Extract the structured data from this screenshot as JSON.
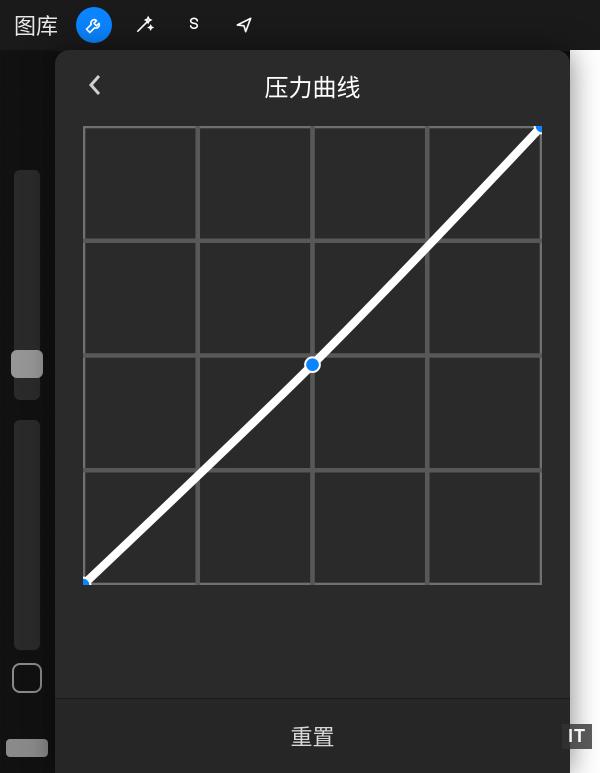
{
  "toolbar": {
    "gallery_label": "图库",
    "icons": {
      "adjust": "wrench-icon",
      "magic": "wand-icon",
      "shape": "s-icon",
      "pointer": "arrow-icon"
    },
    "active": "adjust"
  },
  "panel": {
    "title": "压力曲线",
    "reset_label": "重置"
  },
  "chart_data": {
    "type": "line",
    "title": "压力曲线",
    "xlabel": "",
    "ylabel": "",
    "xlim": [
      0,
      1
    ],
    "ylim": [
      0,
      1
    ],
    "grid_rows": 4,
    "grid_cols": 4,
    "series": [
      {
        "name": "pressure-curve",
        "x": [
          0,
          0.5,
          1
        ],
        "y": [
          0,
          0.48,
          1
        ]
      }
    ],
    "control_points": [
      {
        "x": 0.0,
        "y": 0.0
      },
      {
        "x": 0.5,
        "y": 0.48
      },
      {
        "x": 1.0,
        "y": 1.0
      }
    ]
  },
  "colors": {
    "accent": "#0a84ff",
    "panel_bg": "#2a2a2a",
    "canvas_bg": "#101010"
  },
  "sliders": {
    "brush_size": 0.8,
    "opacity": 0.0
  },
  "watermark": "IT"
}
